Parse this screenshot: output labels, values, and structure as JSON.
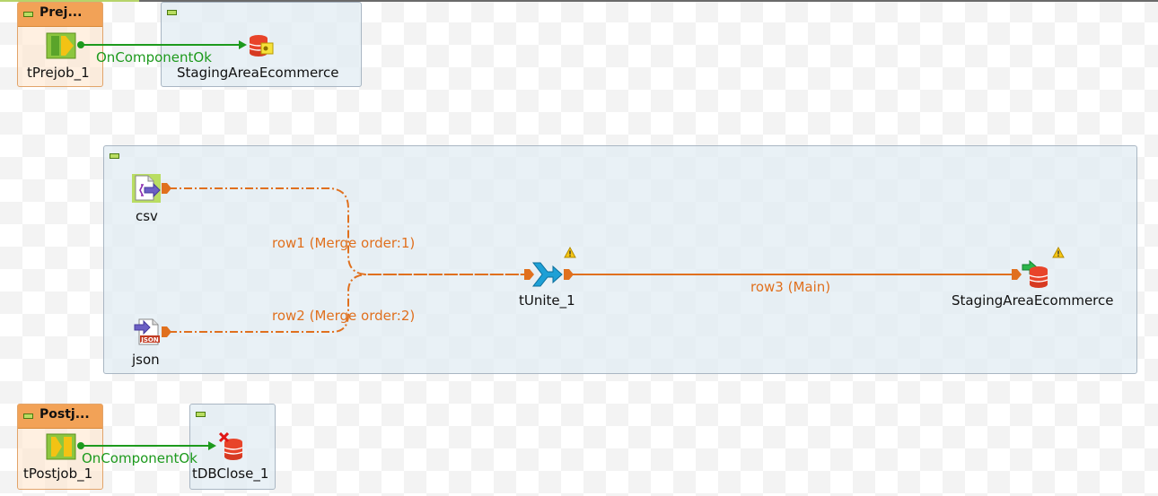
{
  "canvas": {
    "prejob": {
      "subjob_title": "Prej...",
      "component_label": "tPrejob_1",
      "target_label": "StagingAreaEcommerce",
      "link_label": "OnComponentOk"
    },
    "main_subjob": {
      "components": {
        "csv": "csv",
        "json": "json",
        "unite": "tUnite_1",
        "output": "StagingAreaEcommerce"
      },
      "links": {
        "row1": "row1 (Merge order:1)",
        "row2": "row2 (Merge order:2)",
        "row3": "row3 (Main)"
      }
    },
    "postjob": {
      "subjob_title": "Postj...",
      "component_label": "tPostjob_1",
      "target_label": "tDBClose_1",
      "link_label": "OnComponentOk"
    }
  },
  "colors": {
    "trigger_link": "#1d9a1d",
    "row_link": "#e0701e",
    "subjob_header": "#f2a257"
  },
  "icons": {
    "prejob": "prejob-icon",
    "db_connection": "db-connection-icon",
    "csv_input": "csv-input-icon",
    "json_input": "json-input-icon",
    "unite": "unite-icon",
    "db_output": "db-output-icon",
    "warning": "warning-icon",
    "postjob": "postjob-icon",
    "db_close": "db-close-icon"
  }
}
